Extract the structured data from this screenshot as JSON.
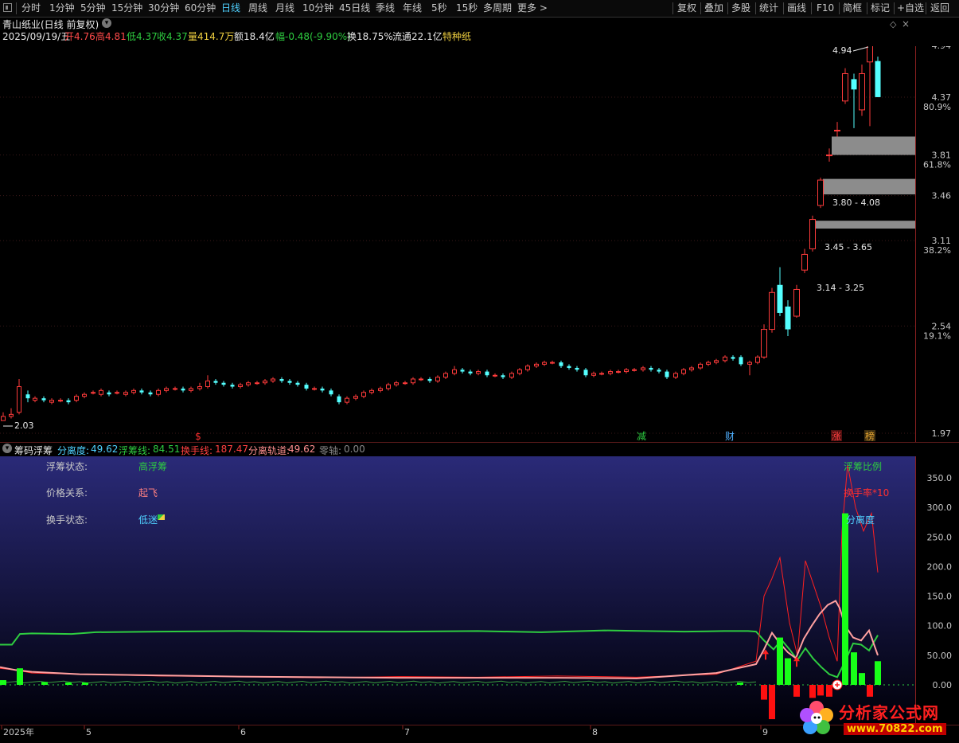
{
  "toolbar": {
    "periods": [
      "分时",
      "1分钟",
      "5分钟",
      "15分钟",
      "30分钟",
      "60分钟",
      "日线",
      "周线",
      "月线",
      "10分钟",
      "45日线",
      "季线",
      "年线",
      "5秒",
      "15秒",
      "多周期",
      "更多 >"
    ],
    "active_period": "日线",
    "right_buttons": [
      "复权",
      "叠加",
      "多股",
      "统计",
      "画线",
      "F10",
      "简框",
      "标记",
      "+自选",
      "返回"
    ]
  },
  "stock": {
    "title": "青山纸业(日线 前复权)",
    "date": "2025/09/19/五",
    "open": "开4.76",
    "high": "高4.81",
    "low": "低4.37",
    "close": "收4.37",
    "volume": "量414.7万",
    "amount": "额18.4亿",
    "change": "幅-0.48(-9.90%)",
    "turnover": "换18.75%",
    "float": "流通22.1亿",
    "sector": "特种纸"
  },
  "price_axis": [
    {
      "price": "4.94",
      "pct": ""
    },
    {
      "price": "4.37",
      "pct": "80.9%"
    },
    {
      "price": "3.81",
      "pct": "61.8%"
    },
    {
      "price": "3.46",
      "pct": ""
    },
    {
      "price": "3.11",
      "pct": "38.2%"
    },
    {
      "price": "2.54",
      "pct": "19.1%"
    },
    {
      "price": "1.97",
      "pct": ""
    }
  ],
  "annotations": {
    "high_marker": "4.94",
    "low_marker": "2.03",
    "zone1": "3.80 - 4.08",
    "zone2": "3.45 - 3.65",
    "zone3": "3.14 - 3.25"
  },
  "event_markers": [
    {
      "label": "$",
      "color": "#ff3030"
    },
    {
      "label": "减",
      "color": "#2ecc40"
    },
    {
      "label": "财",
      "color": "#4fb0ff"
    },
    {
      "label": "涨",
      "color": "#ff4040"
    },
    {
      "label": "榜",
      "color": "#e0a030"
    }
  ],
  "indicator": {
    "name": "筹码浮筹",
    "fields": [
      {
        "label": "分离度:",
        "value": "49.62",
        "color": "#4fd1ff"
      },
      {
        "label": "浮筹线:",
        "value": "84.51",
        "color": "#2ecc40"
      },
      {
        "label": "换手线:",
        "value": "187.47",
        "color": "#ff4040"
      },
      {
        "label": "分离轨道:",
        "value": "49.62",
        "color": "#ff9090"
      },
      {
        "label": "零轴:",
        "value": "0.00",
        "color": "#888888"
      }
    ],
    "status": [
      {
        "label": "浮筹状态:",
        "value": "高浮筹",
        "color": "#2ecc40"
      },
      {
        "label": "价格关系:",
        "value": "起飞",
        "color": "#ff8080"
      },
      {
        "label": "换手状态:",
        "value": "低迷",
        "color": "#4fd1ff"
      }
    ],
    "legend": [
      {
        "text": "浮筹比例",
        "color": "#2ecc40"
      },
      {
        "text": "换手率*10",
        "color": "#ff3030"
      },
      {
        "text": "分离度",
        "color": "#4fd1ff"
      }
    ],
    "scale": [
      "350.0",
      "300.0",
      "250.0",
      "200.0",
      "150.0",
      "100.0",
      "50.00",
      "0.00"
    ]
  },
  "time_axis": [
    "2025年",
    "5",
    "6",
    "7",
    "8",
    "9"
  ],
  "watermark": {
    "title": "分析家公式网",
    "url": "www.70822.com"
  },
  "colors": {
    "up": "#ff3b3b",
    "down": "#54ffff",
    "purple": "#c020c0",
    "zone": "#8c8c8c"
  }
}
